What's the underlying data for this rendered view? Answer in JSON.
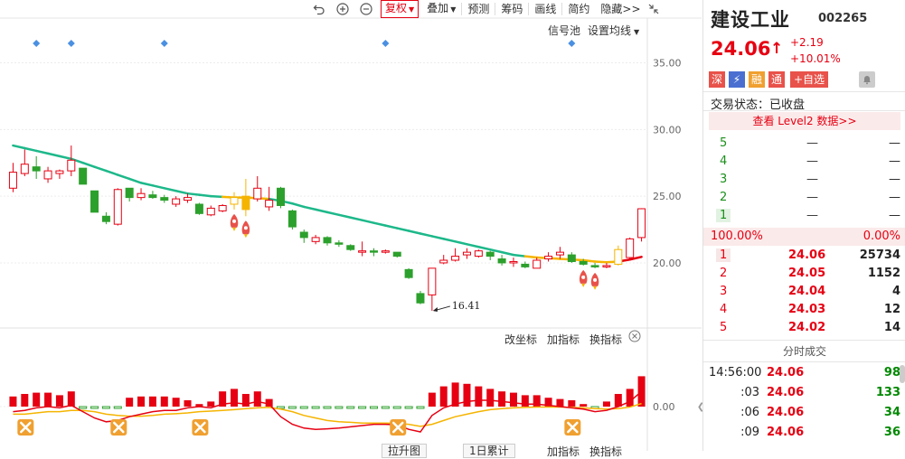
{
  "colors": {
    "up": "#e60012",
    "down": "#2ca02c",
    "ma": "#1db88a",
    "ma_up": "#f5b400",
    "ma_down": "#e60012",
    "grid": "#ececec"
  },
  "toolbar": {
    "icons": [
      "undo-icon",
      "zoom-in-icon",
      "zoom-out-icon"
    ],
    "fuquan": "复权",
    "items": [
      "叠加",
      "预测",
      "筹码",
      "画线",
      "简约",
      "隐藏>>"
    ],
    "dropdown_items": [
      "叠加"
    ]
  },
  "chart_header": {
    "signal_pool": "信号池",
    "set_ma": "设置均线"
  },
  "subchart_header": {
    "change_axis": "改坐标",
    "add_indicator": "加指标",
    "switch_indicator": "换指标"
  },
  "bottom_bar": {
    "left_dropdown": "拉升图",
    "middle_dropdown": "1日累计",
    "add_indicator": "加指标",
    "switch_indicator": "换指标"
  },
  "chart_data": {
    "type": "candlestick",
    "y_ticks": [
      "35.00",
      "30.00",
      "25.00",
      "20.00"
    ],
    "ylim": [
      16.0,
      37.0
    ],
    "low_label": "16.41",
    "sub_y_tick": "0.00",
    "candles": [
      {
        "o": 25.6,
        "c": 26.8,
        "h": 27.5,
        "l": 25.3
      },
      {
        "o": 26.7,
        "c": 27.4,
        "h": 28.5,
        "l": 26.5
      },
      {
        "o": 27.2,
        "c": 26.9,
        "h": 28.0,
        "l": 26.3
      },
      {
        "o": 26.3,
        "c": 26.9,
        "h": 27.2,
        "l": 26.0
      },
      {
        "o": 26.7,
        "c": 26.9,
        "h": 27.0,
        "l": 26.3
      },
      {
        "o": 26.9,
        "c": 27.7,
        "h": 28.8,
        "l": 26.5
      },
      {
        "o": 27.1,
        "c": 25.9,
        "h": 27.1,
        "l": 25.9
      },
      {
        "o": 25.4,
        "c": 23.8,
        "h": 25.4,
        "l": 23.8
      },
      {
        "o": 23.5,
        "c": 23.1,
        "h": 23.8,
        "l": 22.9
      },
      {
        "o": 22.9,
        "c": 25.5,
        "h": 25.6,
        "l": 22.8
      },
      {
        "o": 25.6,
        "c": 24.9,
        "h": 25.6,
        "l": 24.6
      },
      {
        "o": 24.9,
        "c": 25.2,
        "h": 25.6,
        "l": 24.7
      },
      {
        "o": 25.1,
        "c": 24.9,
        "h": 25.4,
        "l": 24.8
      },
      {
        "o": 24.9,
        "c": 24.7,
        "h": 25.1,
        "l": 24.5
      },
      {
        "o": 24.4,
        "c": 24.8,
        "h": 25.0,
        "l": 24.2
      },
      {
        "o": 24.7,
        "c": 24.9,
        "h": 25.2,
        "l": 24.5
      },
      {
        "o": 24.4,
        "c": 23.7,
        "h": 24.5,
        "l": 23.6
      },
      {
        "o": 23.6,
        "c": 24.1,
        "h": 24.3,
        "l": 23.5
      },
      {
        "o": 23.9,
        "c": 24.3,
        "h": 24.4,
        "l": 23.8
      },
      {
        "o": 24.4,
        "c": 24.9,
        "h": 25.3,
        "l": 24.0
      },
      {
        "o": 25.0,
        "c": 24.0,
        "h": 26.3,
        "l": 23.5
      },
      {
        "o": 24.8,
        "c": 25.6,
        "h": 26.5,
        "l": 24.6
      },
      {
        "o": 24.2,
        "c": 24.7,
        "h": 25.7,
        "l": 23.9
      },
      {
        "o": 25.6,
        "c": 24.3,
        "h": 25.7,
        "l": 24.1
      },
      {
        "o": 23.9,
        "c": 22.7,
        "h": 24.0,
        "l": 22.5
      },
      {
        "o": 22.3,
        "c": 21.9,
        "h": 22.5,
        "l": 21.5
      },
      {
        "o": 21.6,
        "c": 21.9,
        "h": 22.1,
        "l": 21.4
      },
      {
        "o": 21.9,
        "c": 21.5,
        "h": 22.0,
        "l": 21.3
      },
      {
        "o": 21.5,
        "c": 21.4,
        "h": 21.7,
        "l": 21.2
      },
      {
        "o": 21.3,
        "c": 21.0,
        "h": 21.4,
        "l": 20.9
      },
      {
        "o": 20.9,
        "c": 20.9,
        "h": 21.6,
        "l": 20.5
      },
      {
        "o": 20.9,
        "c": 20.8,
        "h": 21.1,
        "l": 20.5
      },
      {
        "o": 20.8,
        "c": 20.9,
        "h": 21.0,
        "l": 20.7
      },
      {
        "o": 20.8,
        "c": 20.5,
        "h": 20.8,
        "l": 20.4
      },
      {
        "o": 19.5,
        "c": 18.9,
        "h": 19.6,
        "l": 18.8
      },
      {
        "o": 17.7,
        "c": 17.0,
        "h": 17.9,
        "l": 16.9
      },
      {
        "o": 17.6,
        "c": 19.6,
        "h": 19.6,
        "l": 16.41
      },
      {
        "o": 20.0,
        "c": 20.2,
        "h": 20.6,
        "l": 19.9
      },
      {
        "o": 20.2,
        "c": 20.5,
        "h": 21.1,
        "l": 20.1
      },
      {
        "o": 20.6,
        "c": 20.8,
        "h": 21.1,
        "l": 20.3
      },
      {
        "o": 20.5,
        "c": 20.9,
        "h": 21.0,
        "l": 20.4
      },
      {
        "o": 20.8,
        "c": 20.5,
        "h": 20.9,
        "l": 20.2
      },
      {
        "o": 20.3,
        "c": 20.0,
        "h": 20.6,
        "l": 19.8
      },
      {
        "o": 20.1,
        "c": 20.1,
        "h": 20.4,
        "l": 19.7
      },
      {
        "o": 19.9,
        "c": 19.7,
        "h": 20.1,
        "l": 19.6
      },
      {
        "o": 19.6,
        "c": 20.2,
        "h": 20.4,
        "l": 19.6
      },
      {
        "o": 20.3,
        "c": 20.5,
        "h": 20.8,
        "l": 20.1
      },
      {
        "o": 20.6,
        "c": 20.8,
        "h": 21.2,
        "l": 20.3
      },
      {
        "o": 20.6,
        "c": 20.1,
        "h": 20.8,
        "l": 20.0
      },
      {
        "o": 20.1,
        "c": 19.9,
        "h": 20.3,
        "l": 19.8
      },
      {
        "o": 19.8,
        "c": 19.7,
        "h": 20.0,
        "l": 19.6
      },
      {
        "o": 19.8,
        "c": 19.8,
        "h": 20.0,
        "l": 19.6
      },
      {
        "o": 19.9,
        "c": 21.0,
        "h": 21.3,
        "l": 19.8
      },
      {
        "o": 20.4,
        "c": 21.8,
        "h": 21.9,
        "l": 20.3
      },
      {
        "o": 21.9,
        "c": 24.06,
        "h": 24.1,
        "l": 21.6
      }
    ],
    "ma": [
      28.8,
      28.6,
      28.4,
      28.2,
      28.0,
      27.8,
      27.5,
      27.2,
      26.9,
      26.6,
      26.3,
      26.0,
      25.8,
      25.6,
      25.4,
      25.2,
      25.1,
      25.0,
      24.95,
      24.9,
      24.9,
      24.85,
      24.8,
      24.65,
      24.45,
      24.2,
      24.0,
      23.8,
      23.6,
      23.4,
      23.2,
      23.0,
      22.8,
      22.6,
      22.4,
      22.2,
      22.0,
      21.8,
      21.6,
      21.4,
      21.2,
      21.0,
      20.8,
      20.6,
      20.5,
      20.4,
      20.35,
      20.3,
      20.25,
      20.2,
      20.1,
      20.05,
      20.1,
      20.25,
      20.45
    ],
    "signal_markers": [
      2,
      5,
      13,
      32,
      48
    ],
    "rockets": [
      19,
      20,
      49,
      50
    ],
    "macd": [
      0.4,
      0.5,
      0.55,
      0.55,
      0.45,
      0.6,
      -0.3,
      -0.45,
      -0.35,
      -0.15,
      0.35,
      0.4,
      0.4,
      0.4,
      0.35,
      0.25,
      0.1,
      0.2,
      0.6,
      0.7,
      0.5,
      0.6,
      0.3,
      -0.5,
      -0.7,
      -0.7,
      -0.6,
      -0.55,
      -0.45,
      -0.35,
      -0.25,
      -0.15,
      -0.15,
      -0.2,
      -0.5,
      -0.4,
      0.55,
      0.8,
      0.95,
      0.9,
      0.8,
      0.7,
      0.6,
      0.55,
      0.45,
      0.45,
      0.35,
      0.3,
      0.25,
      0.1,
      -0.1,
      0.2,
      0.5,
      0.7,
      1.2
    ],
    "dif": [
      -0.2,
      -0.15,
      -0.05,
      0.0,
      -0.05,
      0.05,
      -0.2,
      -0.45,
      -0.6,
      -0.55,
      -0.4,
      -0.3,
      -0.2,
      -0.15,
      -0.15,
      -0.05,
      0.0,
      -0.05,
      0.1,
      0.15,
      0.1,
      0.2,
      0.1,
      -0.4,
      -0.7,
      -0.85,
      -0.9,
      -0.88,
      -0.85,
      -0.8,
      -0.75,
      -0.7,
      -0.7,
      -0.72,
      -0.9,
      -1.0,
      -0.35,
      -0.05,
      0.1,
      0.2,
      0.25,
      0.25,
      0.2,
      0.15,
      0.1,
      0.1,
      0.05,
      0.0,
      -0.05,
      -0.1,
      -0.2,
      -0.15,
      0.0,
      0.2,
      0.6
    ],
    "dea": [
      -0.3,
      -0.3,
      -0.25,
      -0.2,
      -0.2,
      -0.15,
      -0.15,
      -0.2,
      -0.3,
      -0.35,
      -0.38,
      -0.38,
      -0.35,
      -0.3,
      -0.28,
      -0.25,
      -0.2,
      -0.18,
      -0.15,
      -0.12,
      -0.08,
      -0.05,
      -0.03,
      -0.1,
      -0.2,
      -0.35,
      -0.45,
      -0.55,
      -0.6,
      -0.62,
      -0.65,
      -0.65,
      -0.65,
      -0.66,
      -0.7,
      -0.78,
      -0.7,
      -0.55,
      -0.4,
      -0.3,
      -0.2,
      -0.12,
      -0.08,
      -0.05,
      -0.03,
      -0.02,
      -0.02,
      -0.02,
      -0.03,
      -0.05,
      -0.08,
      -0.1,
      -0.08,
      -0.02,
      0.12
    ],
    "x_signals": [
      1,
      9,
      16,
      33,
      48
    ]
  },
  "stock": {
    "name": "建设工业",
    "code": "002265",
    "price": "24.06",
    "arrow": "↑",
    "change": "+2.19",
    "change_pct": "+10.01%",
    "badges": [
      "深",
      "⚡",
      "融",
      "通"
    ],
    "add_watch": "+自选",
    "trade_status": "交易状态：已收盘",
    "level2": "查看 Level2 数据>>"
  },
  "sell_orders": [
    {
      "level": "5",
      "price": "—",
      "volume": "—"
    },
    {
      "level": "4",
      "price": "—",
      "volume": "—"
    },
    {
      "level": "3",
      "price": "—",
      "volume": "—"
    },
    {
      "level": "2",
      "price": "—",
      "volume": "—"
    },
    {
      "level": "1",
      "price": "—",
      "volume": "—"
    }
  ],
  "ratio": {
    "left": "100.00%",
    "right": "0.00%"
  },
  "buy_orders": [
    {
      "level": "1",
      "price": "24.06",
      "volume": "25734"
    },
    {
      "level": "2",
      "price": "24.05",
      "volume": "1152"
    },
    {
      "level": "3",
      "price": "24.04",
      "volume": "4"
    },
    {
      "level": "4",
      "price": "24.03",
      "volume": "12"
    },
    {
      "level": "5",
      "price": "24.02",
      "volume": "14"
    }
  ],
  "fenshi_title": "分时成交",
  "ticks": [
    {
      "time": "14:56:00",
      "price": "24.06",
      "volume": "98"
    },
    {
      "time": ":03",
      "price": "24.06",
      "volume": "133"
    },
    {
      "time": ":06",
      "price": "24.06",
      "volume": "34"
    },
    {
      "time": ":09",
      "price": "24.06",
      "volume": "36"
    }
  ]
}
